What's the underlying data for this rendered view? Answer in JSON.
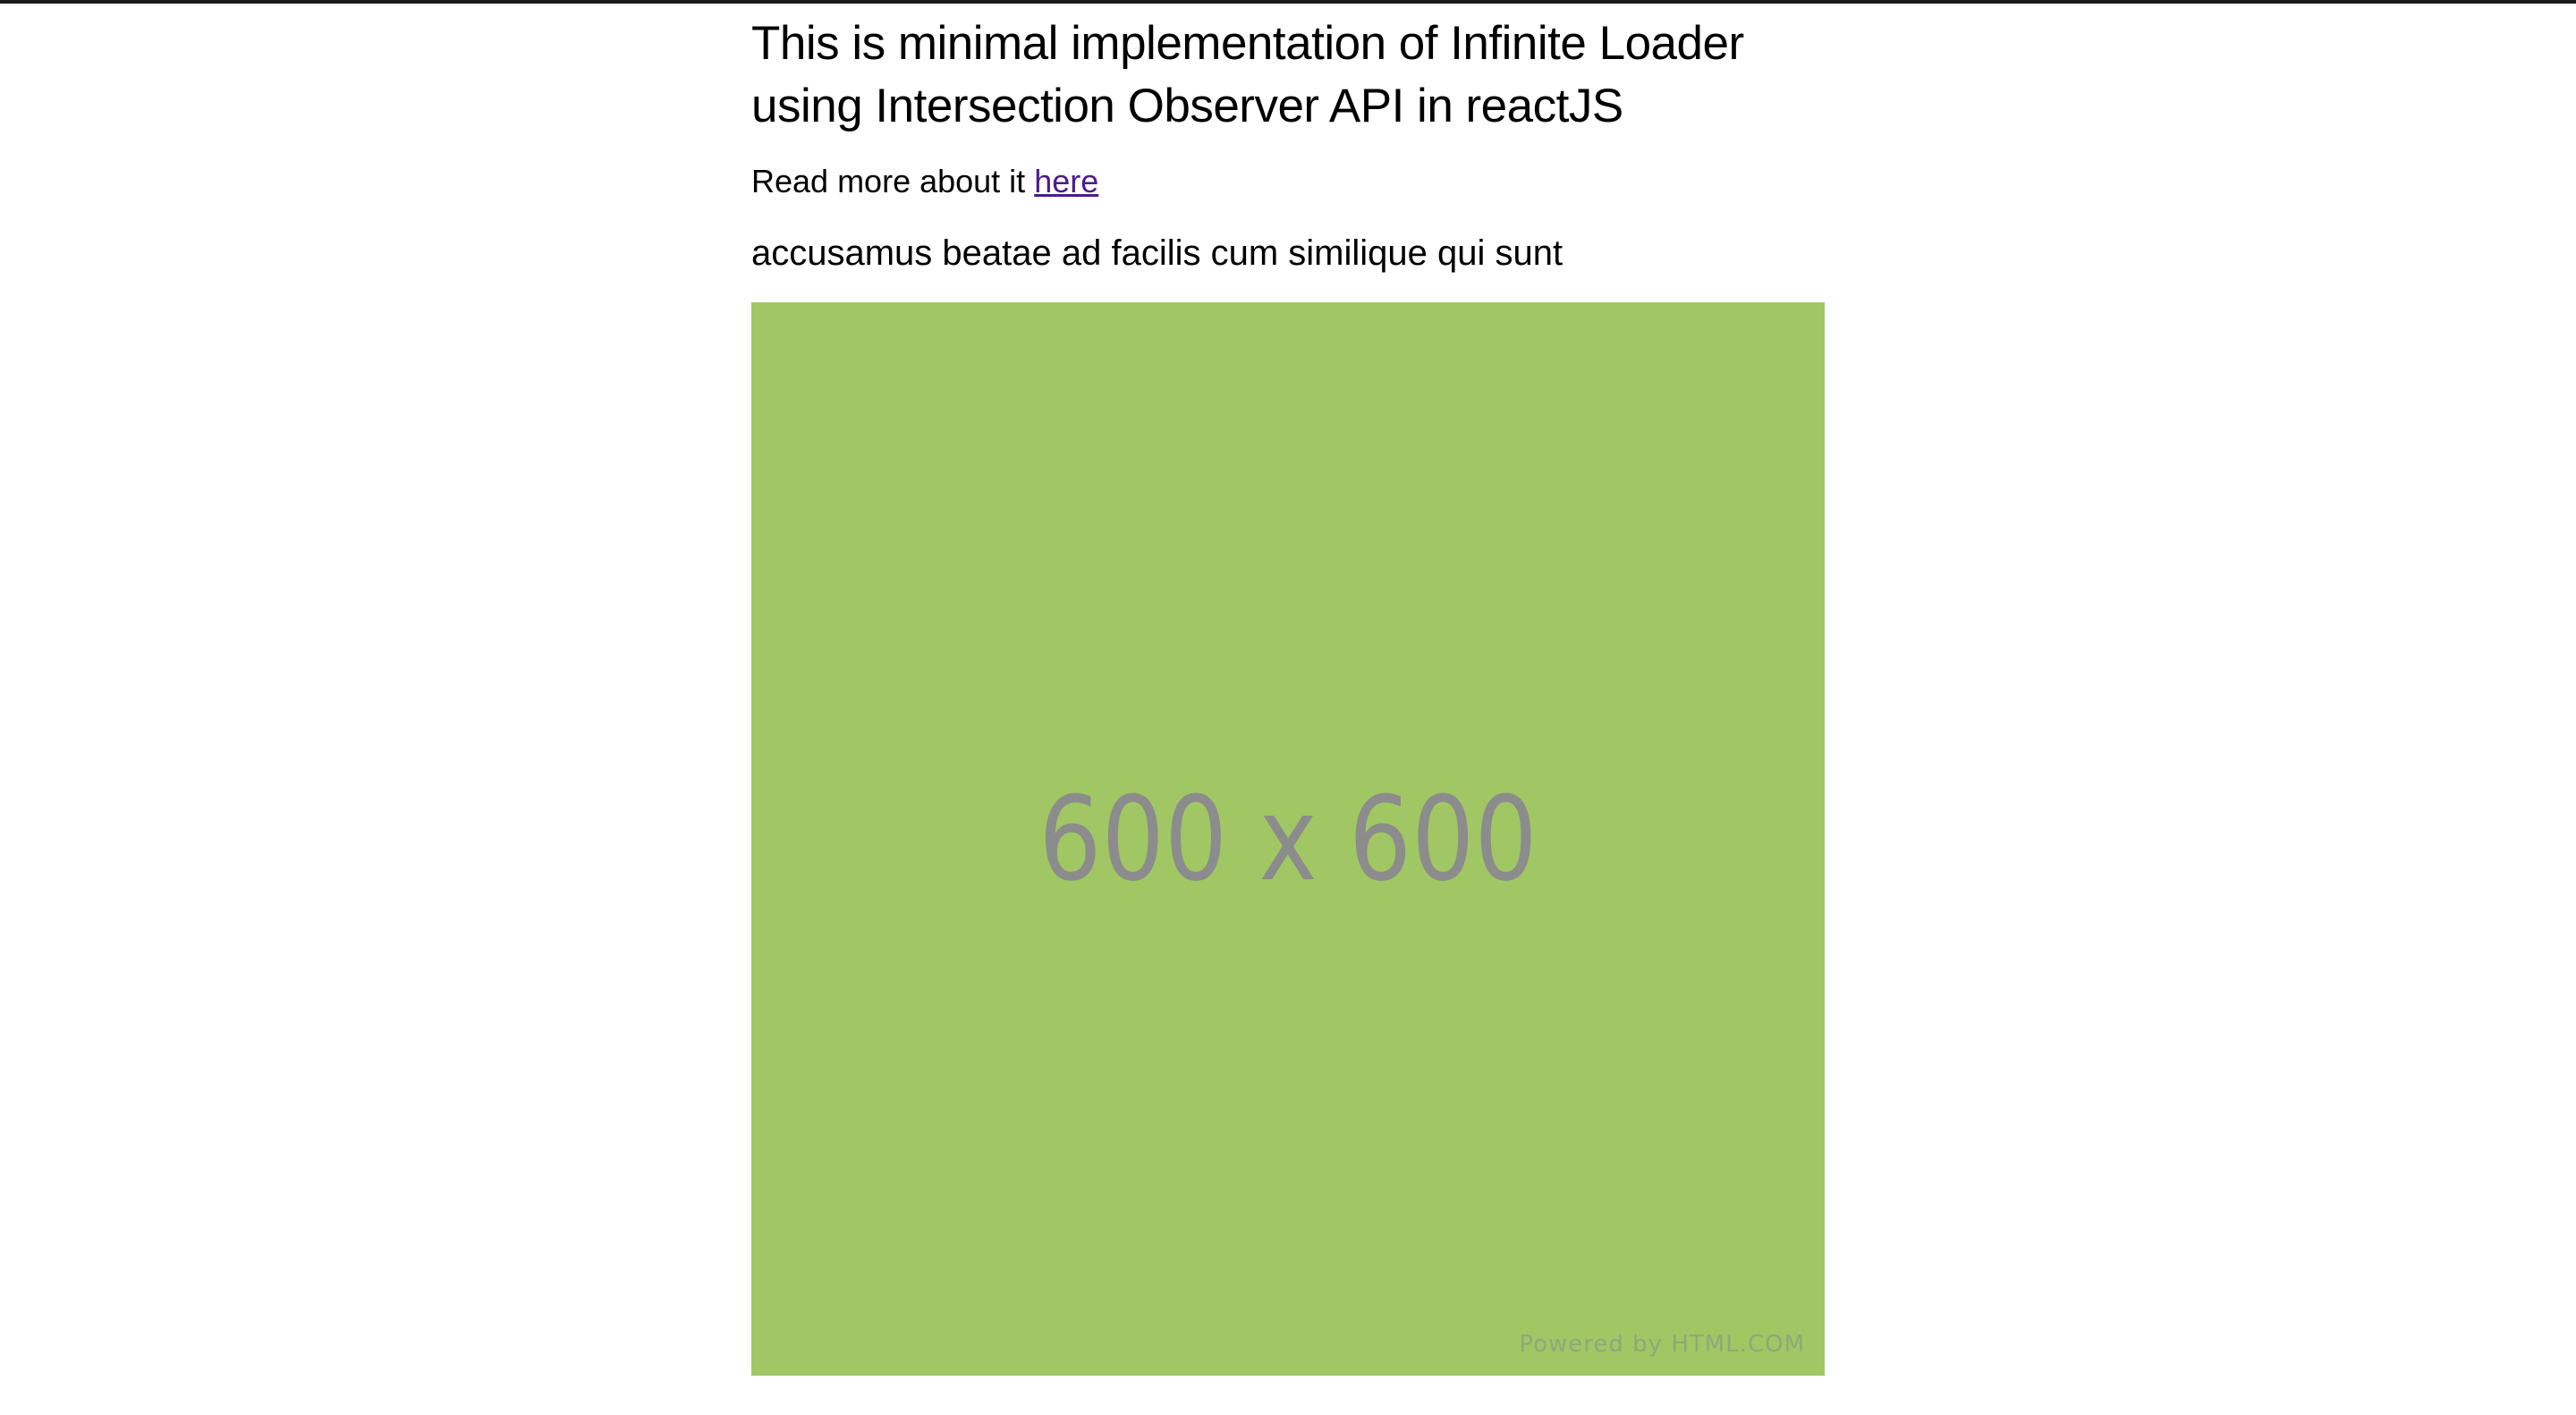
{
  "page": {
    "title": "This is minimal implementation of Infinite Loader using Intersection Observer API in reactJS",
    "read_more_prefix": "Read more about it ",
    "read_more_link": "here"
  },
  "items": [
    {
      "title": "accusamus beatae ad facilis cum similique qui sunt",
      "image": {
        "label": "600 x 600",
        "powered_by": "Powered by HTML.COM",
        "background_color": "#a0c764"
      }
    }
  ],
  "colors": {
    "link": "#4b1b8a",
    "placeholder_text": "#8c8c8c"
  }
}
